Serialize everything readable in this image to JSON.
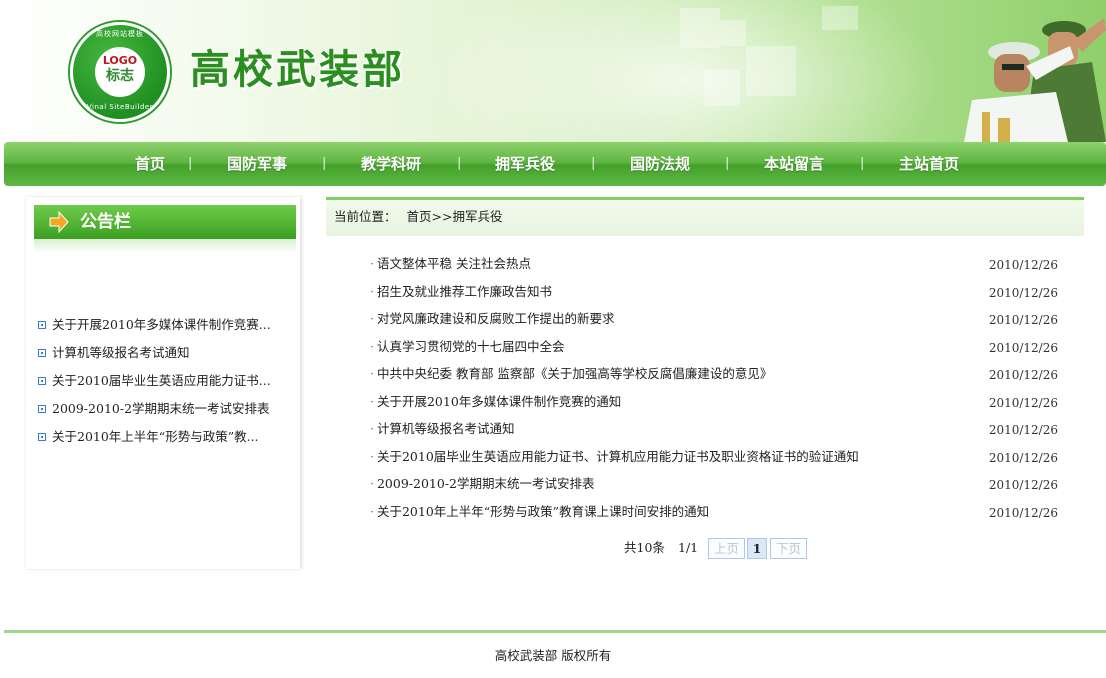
{
  "header": {
    "logo_text": "LOGO",
    "logo_sub": "标志",
    "logo_ring_top": "高校网站模板",
    "logo_ring_bottom": "Vinal SiteBuilder",
    "site_title": "高校武装部"
  },
  "nav": {
    "items": [
      {
        "label": "首页"
      },
      {
        "label": "国防军事"
      },
      {
        "label": "教学科研"
      },
      {
        "label": "拥军兵役"
      },
      {
        "label": "国防法规"
      },
      {
        "label": "本站留言"
      },
      {
        "label": "主站首页"
      }
    ],
    "separator": "|"
  },
  "notice": {
    "title": "公告栏",
    "items": [
      {
        "text": "关于开展2010年多媒体课件制作竞赛..."
      },
      {
        "text": "计算机等级报名考试通知"
      },
      {
        "text": "关于2010届毕业生英语应用能力证书..."
      },
      {
        "text": "2009-2010-2学期期末统一考试安排表"
      },
      {
        "text": "关于2010年上半年“形势与政策”教..."
      }
    ]
  },
  "breadcrumb": {
    "prefix": "当前位置：",
    "path": "首页>>拥军兵役"
  },
  "articles": [
    {
      "title": "语文整体平稳  关注社会热点",
      "date": "2010/12/26"
    },
    {
      "title": "招生及就业推荐工作廉政告知书",
      "date": "2010/12/26"
    },
    {
      "title": "对党风廉政建设和反腐败工作提出的新要求",
      "date": "2010/12/26"
    },
    {
      "title": "认真学习贯彻党的十七届四中全会",
      "date": "2010/12/26"
    },
    {
      "title": "中共中央纪委  教育部  监察部《关于加强高等学校反腐倡廉建设的意见》",
      "date": "2010/12/26"
    },
    {
      "title": "关于开展2010年多媒体课件制作竞赛的通知",
      "date": "2010/12/26"
    },
    {
      "title": "计算机等级报名考试通知",
      "date": "2010/12/26"
    },
    {
      "title": "关于2010届毕业生英语应用能力证书、计算机应用能力证书及职业资格证书的验证通知",
      "date": "2010/12/26"
    },
    {
      "title": "2009-2010-2学期期末统一考试安排表",
      "date": "2010/12/26"
    },
    {
      "title": "关于2010年上半年“形势与政策”教育课上课时间安排的通知",
      "date": "2010/12/26"
    }
  ],
  "pager": {
    "total": "共10条",
    "pages": "1/1",
    "prev": "上页",
    "current": "1",
    "next": "下页"
  },
  "footer": {
    "copyright": "高校武装部  版权所有"
  },
  "colors": {
    "brand_green": "#2a8f1e",
    "nav_green": "#4aa52f",
    "accent_light_green": "#7fd05f"
  }
}
